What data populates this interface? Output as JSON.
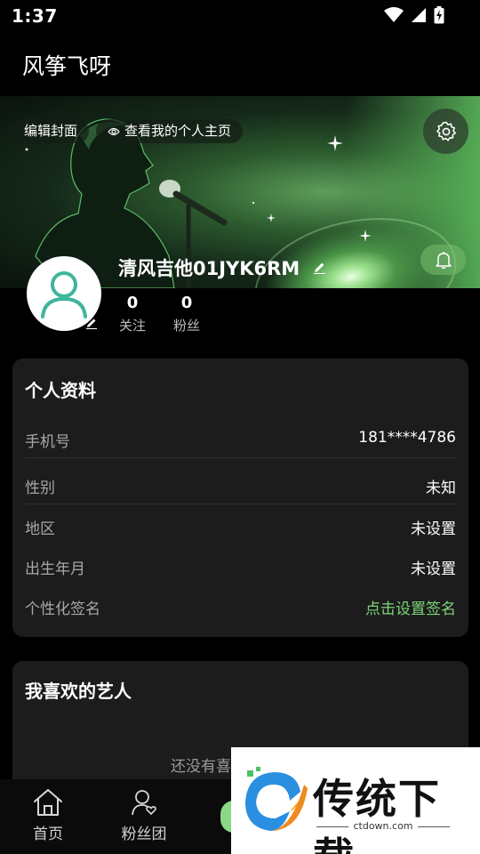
{
  "status_bar": {
    "time": "1:37"
  },
  "app_title": "风筝飞呀",
  "banner": {
    "edit_cover": "编辑封面",
    "view_homepage": "查看我的个人主页"
  },
  "profile": {
    "username": "清风吉他01JYK6RM",
    "stats": [
      {
        "value": "0",
        "label": "关注"
      },
      {
        "value": "0",
        "label": "粉丝"
      }
    ]
  },
  "info_card": {
    "title": "个人资料",
    "rows": [
      {
        "label": "手机号",
        "value": "181****4786"
      },
      {
        "label": "性别",
        "value": "未知"
      },
      {
        "label": "地区",
        "value": "未设置"
      },
      {
        "label": "出生年月",
        "value": "未设置"
      },
      {
        "label": "个性化签名",
        "value": "点击设置签名"
      }
    ]
  },
  "artists_card": {
    "title": "我喜欢的艺人",
    "empty_text": "还没有喜"
  },
  "bottom_nav": [
    {
      "label": "首页"
    },
    {
      "label": "粉丝团"
    }
  ],
  "watermark": {
    "brand": "传统下载",
    "url": "ctdown.com"
  },
  "colors": {
    "accent": "#7ed57a",
    "card_bg": "#1c1c1c",
    "page_bg": "#000000"
  }
}
